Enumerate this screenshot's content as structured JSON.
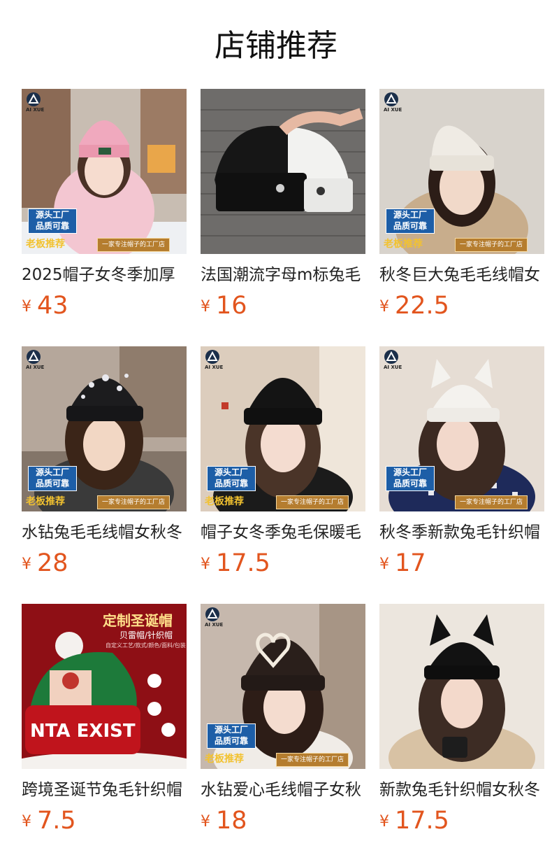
{
  "page": {
    "title": "店铺推荐"
  },
  "overlay": {
    "badge_line1": "源头工厂",
    "badge_line2": "品质可靠",
    "boss_tag": "老板推荐",
    "slogan": "一家专注帽子的工厂店",
    "brand": "AI XUE"
  },
  "xmas": {
    "title": "定制圣诞帽",
    "subtitle": "贝雷帽/针织帽",
    "note": "自定义工艺/款式/颜色/面料/包装",
    "hat_text": "NTA EXIST"
  },
  "products": [
    {
      "name": "2025帽子女冬季加厚",
      "currency": "¥",
      "price": "43",
      "hat_color": "#f0a9be",
      "bg": "#cfc2b8"
    },
    {
      "name": "法国潮流字母m标兔毛",
      "currency": "¥",
      "price": "16",
      "hat_color": "#1a1a1a",
      "bg": "#6c6c6c"
    },
    {
      "name": "秋冬巨大兔毛毛线帽女",
      "currency": "¥",
      "price": "22.5",
      "hat_color": "#eeeae2",
      "bg": "#8a7a6a"
    },
    {
      "name": "水钻兔毛毛线帽女秋冬",
      "currency": "¥",
      "price": "28",
      "hat_color": "#1c1c1e",
      "bg": "#a89a90"
    },
    {
      "name": "帽子女冬季兔毛保暖毛",
      "currency": "¥",
      "price": "17.5",
      "hat_color": "#151515",
      "bg": "#d9c9b8"
    },
    {
      "name": "秋冬季新款兔毛针织帽",
      "currency": "¥",
      "price": "17",
      "hat_color": "#f2f0ec",
      "bg": "#e6ddd4"
    },
    {
      "name": "跨境圣诞节兔毛针织帽",
      "currency": "¥",
      "price": "7.5",
      "hat_color": "#c0141c",
      "bg": "#8e0f15"
    },
    {
      "name": "水钻爱心毛线帽子女秋",
      "currency": "¥",
      "price": "18",
      "hat_color": "#2a1f1b",
      "bg": "#b9aba0"
    },
    {
      "name": "新款兔毛针织帽女秋冬",
      "currency": "¥",
      "price": "17.5",
      "hat_color": "#121212",
      "bg": "#e9e2da"
    }
  ]
}
